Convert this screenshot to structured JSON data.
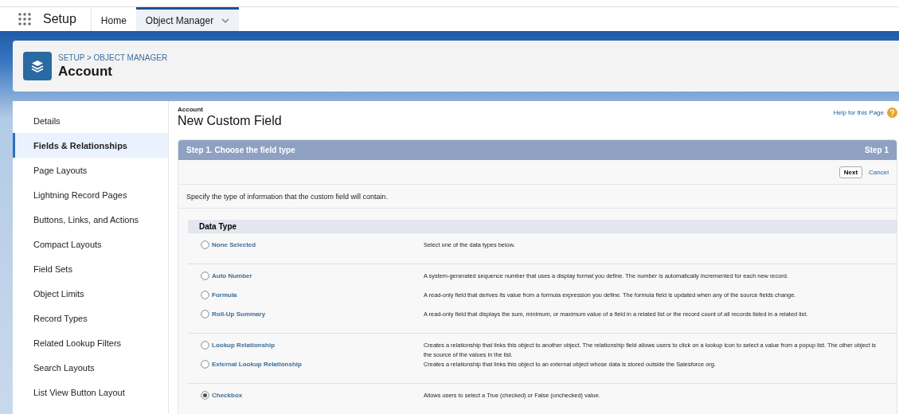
{
  "nav": {
    "app_name": "Setup",
    "tabs": [
      {
        "label": "Home",
        "selected": false,
        "has_menu": false
      },
      {
        "label": "Object Manager",
        "selected": true,
        "has_menu": true
      }
    ]
  },
  "header": {
    "breadcrumb": "SETUP > OBJECT MANAGER",
    "title": "Account"
  },
  "sidebar": {
    "items": [
      {
        "label": "Details",
        "selected": false
      },
      {
        "label": "Fields & Relationships",
        "selected": true
      },
      {
        "label": "Page Layouts",
        "selected": false
      },
      {
        "label": "Lightning Record Pages",
        "selected": false
      },
      {
        "label": "Buttons, Links, and Actions",
        "selected": false
      },
      {
        "label": "Compact Layouts",
        "selected": false
      },
      {
        "label": "Field Sets",
        "selected": false
      },
      {
        "label": "Object Limits",
        "selected": false
      },
      {
        "label": "Record Types",
        "selected": false
      },
      {
        "label": "Related Lookup Filters",
        "selected": false
      },
      {
        "label": "Search Layouts",
        "selected": false
      },
      {
        "label": "List View Button Layout",
        "selected": false
      }
    ]
  },
  "page": {
    "object": "Account",
    "title": "New Custom Field",
    "help_link": "Help for this Page",
    "step_title": "Step 1. Choose the field type",
    "step_label": "Step 1",
    "buttons": [
      {
        "label": "Next",
        "kind": "button"
      },
      {
        "label": "Cancel",
        "kind": "link"
      }
    ],
    "instructions": "Specify the type of information that the custom field will contain.",
    "section_title": "Data Type",
    "groups": [
      [
        {
          "label": "None Selected",
          "description": "Select one of the data types below.",
          "selected": false
        }
      ],
      [
        {
          "label": "Auto Number",
          "description": "A system-generated sequence number that uses a display format you define. The number is automatically incremented for each new record.",
          "selected": false
        },
        {
          "label": "Formula",
          "description": "A read-only field that derives its value from a formula expression you define. The formula field is updated when any of the source fields change.",
          "selected": false
        },
        {
          "label": "Roll-Up Summary",
          "description": "A read-only field that displays the sum, minimum, or maximum value of a field in a related list or the record count of all records listed in a related list.",
          "selected": false
        }
      ],
      [
        {
          "label": "Lookup Relationship",
          "description": "Creates a relationship that links this object to another object. The relationship field allows users to click on a lookup icon to select a value from a popup list. The other object is the source of the values in the list.",
          "selected": false
        },
        {
          "label": "External Lookup Relationship",
          "description": "Creates a relationship that links this object to an external object whose data is stored outside the Salesforce org.",
          "selected": false
        }
      ],
      [
        {
          "label": "Checkbox",
          "description": "Allows users to select a True (checked) or False (unchecked) value.",
          "selected": true
        }
      ]
    ]
  }
}
